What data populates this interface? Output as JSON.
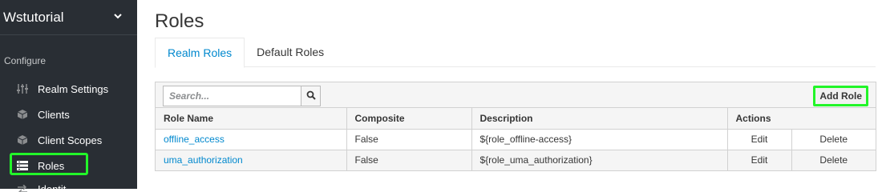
{
  "sidebar": {
    "realm_name": "Wstutorial",
    "section_label": "Configure",
    "items": [
      {
        "label": "Realm Settings",
        "icon": "sliders-icon"
      },
      {
        "label": "Clients",
        "icon": "cube-icon"
      },
      {
        "label": "Client Scopes",
        "icon": "cubes-icon"
      },
      {
        "label": "Roles",
        "icon": "list-icon",
        "active": true
      },
      {
        "label": "Identity Providers",
        "icon": "exchange-icon"
      }
    ],
    "partial_label": "Identit"
  },
  "main": {
    "title": "Roles",
    "tabs": [
      {
        "label": "Realm Roles",
        "active": true
      },
      {
        "label": "Default Roles",
        "active": false
      }
    ],
    "search": {
      "placeholder": "Search..."
    },
    "add_role_label": "Add Role",
    "table": {
      "headers": [
        "Role Name",
        "Composite",
        "Description",
        "Actions"
      ],
      "rows": [
        {
          "name": "offline_access",
          "composite": "False",
          "description": "${role_offline-access}",
          "edit": "Edit",
          "delete": "Delete"
        },
        {
          "name": "uma_authorization",
          "composite": "False",
          "description": "${role_uma_authorization}",
          "edit": "Edit",
          "delete": "Delete"
        }
      ]
    }
  },
  "colors": {
    "sidebar_bg": "#292e34",
    "link": "#0088ce",
    "highlight": "#22f529"
  }
}
